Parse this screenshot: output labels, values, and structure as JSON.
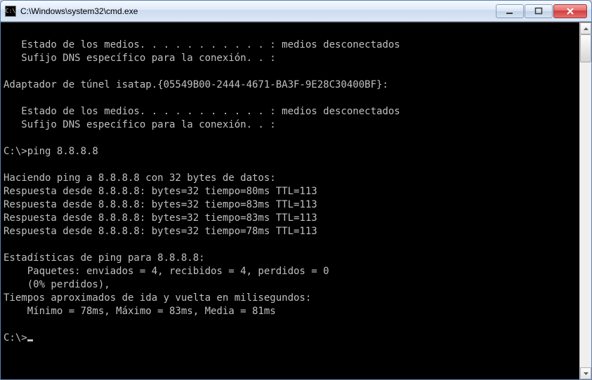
{
  "window": {
    "title": "C:\\Windows\\system32\\cmd.exe"
  },
  "lines": {
    "l0": "",
    "l1": "   Estado de los medios. . . . . . . . . . . : medios desconectados",
    "l2": "   Sufijo DNS específico para la conexión. . :",
    "l3": "",
    "l4": "Adaptador de túnel isatap.{05549B00-2444-4671-BA3F-9E28C30400BF}:",
    "l5": "",
    "l6": "   Estado de los medios. . . . . . . . . . . : medios desconectados",
    "l7": "   Sufijo DNS específico para la conexión. . :",
    "l8": "",
    "l9": "C:\\>ping 8.8.8.8",
    "l10": "",
    "l11": "Haciendo ping a 8.8.8.8 con 32 bytes de datos:",
    "l12": "Respuesta desde 8.8.8.8: bytes=32 tiempo=80ms TTL=113",
    "l13": "Respuesta desde 8.8.8.8: bytes=32 tiempo=83ms TTL=113",
    "l14": "Respuesta desde 8.8.8.8: bytes=32 tiempo=83ms TTL=113",
    "l15": "Respuesta desde 8.8.8.8: bytes=32 tiempo=78ms TTL=113",
    "l16": "",
    "l17": "Estadísticas de ping para 8.8.8.8:",
    "l18": "    Paquetes: enviados = 4, recibidos = 4, perdidos = 0",
    "l19": "    (0% perdidos),",
    "l20": "Tiempos aproximados de ida y vuelta en milisegundos:",
    "l21": "    Mínimo = 78ms, Máximo = 83ms, Media = 81ms",
    "l22": "",
    "l23": "C:\\>"
  }
}
